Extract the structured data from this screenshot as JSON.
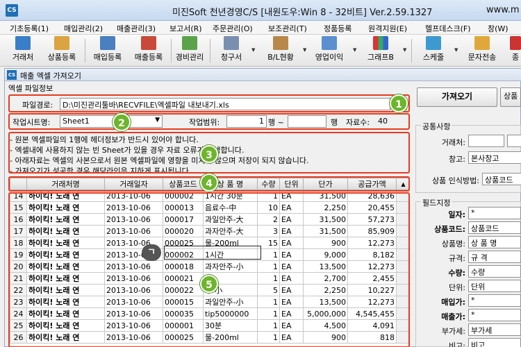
{
  "window": {
    "title": "미진Soft 천년경영C/S [내원도우:Win 8 - 32비트] Ver.2.59.1327",
    "title_tail": "www.m",
    "app_icon": "CS"
  },
  "menu": [
    "기초등록(1)",
    "매입관리(2)",
    "매출관리(3)",
    "보고서(R)",
    "주문관리(O)",
    "보조관리(T)",
    "정품등록",
    "원격지원(E)",
    "헬프데스크(F)",
    "창(W)"
  ],
  "toolbar": [
    "거래처",
    "상품등록",
    "매입등록",
    "매출등록",
    "경비관리",
    "청구서",
    "B/L현황",
    "영업이익",
    "그래프B",
    "스케줄",
    "문자전송",
    "종"
  ],
  "subwindow": {
    "icon": "CS",
    "title": "매출 엑셀 가져오기",
    "group_label": "엑셀 파일정보",
    "path_label": "파일경로:",
    "path_value": "D:\\미진관리툴바\\RECVFILE\\엑셀파일 내보내기.xls",
    "browse_label": "...",
    "sheet_label": "작업시트명:",
    "sheet_value": "Sheet1",
    "range_label": "작업범위:",
    "range_start": "1",
    "range_row1": "행 ~",
    "range_row2": "행",
    "count_label": "자료수:",
    "count_value": "40"
  },
  "notes": [
    "- 원본 엑셀파일의 1행에 헤더정보가 반드시 있어야 합니다.",
    "- 엑셀내에 사용하지 않는 빈 Sheet가 있을 경우 자료 오류가 발생합니다.",
    "- 아래자료는 엑셀의 사본으로서 원본 엑셀파일에 영향을 미치지 않으며 저장이 되지 않습니다.",
    "- 가져오기가 성공한 경우 해당라인은 지하게 표시됩니다."
  ],
  "grid": {
    "headers": [
      "",
      "거래처명",
      "거래일자",
      "상품코드",
      "상 품 명",
      "수량",
      "단위",
      "단가",
      "공급가액",
      "▲"
    ],
    "rows": [
      [
        "14",
        "하이킥! 노래 연",
        "2013-10-06",
        "000002",
        "1시간 30분",
        "1",
        "EA",
        "31,500",
        "28,636"
      ],
      [
        "15",
        "하이킥! 노래 연",
        "2013-10-06",
        "000013",
        "음료수-中",
        "10",
        "EA",
        "2,250",
        "20,455"
      ],
      [
        "16",
        "하이킥! 노래 연",
        "2013-10-06",
        "000017",
        "과일안주-大",
        "2",
        "EA",
        "31,500",
        "57,273"
      ],
      [
        "17",
        "하이킥! 노래 연",
        "2013-10-06",
        "000020",
        "과자안주-大",
        "3",
        "EA",
        "31,500",
        "85,909"
      ],
      [
        "18",
        "하이킥! 노래 연",
        "2013-10-06",
        "000025",
        "물-200ml",
        "15",
        "EA",
        "900",
        "12,273"
      ],
      [
        "19",
        "하이킥! 노래 연",
        "2013-10-06",
        "000002",
        "1시간",
        "1",
        "EA",
        "9,000",
        "8,182"
      ],
      [
        "20",
        "하이킥! 노래 연",
        "2013-10-06",
        "000018",
        "과자안주-小",
        "1",
        "EA",
        "13,500",
        "12,273"
      ],
      [
        "21",
        "하이킥! 노래 연",
        "2013-10-06",
        "000021",
        "주",
        "1",
        "EA",
        "2,700",
        "2,455"
      ],
      [
        "22",
        "하이킥! 노래 연",
        "2013-10-06",
        "000022",
        "주-小",
        "5",
        "EA",
        "2,250",
        "10,227"
      ],
      [
        "23",
        "하이킥! 노래 연",
        "2013-10-06",
        "000015",
        "과일안주-小",
        "1",
        "EA",
        "13,500",
        "12,273"
      ],
      [
        "24",
        "하이킥! 노래 연",
        "2013-10-06",
        "000035",
        "tip5000000",
        "1",
        "EA",
        "5,000,000",
        "4,545,455"
      ],
      [
        "25",
        "하이킥! 노래 연",
        "2013-10-06",
        "000001",
        "30분",
        "1",
        "EA",
        "4,500",
        "4,091"
      ],
      [
        "26",
        "하이킥! 노래 연",
        "2013-10-06",
        "000025",
        "물-200ml",
        "1",
        "EA",
        "900",
        "818"
      ]
    ]
  },
  "right": {
    "import_button": "가져오기",
    "product_button": "상품",
    "common_section": "공통사항",
    "customer_label": "거래처:",
    "warehouse_label": "창고:",
    "warehouse_value": "본사창고",
    "recognize_label": "상품 인식방법:",
    "recognize_value": "상품코드",
    "field_section": "필드지정",
    "fields": [
      {
        "label": "일자:",
        "value": "*",
        "bold": true
      },
      {
        "label": "상품코드:",
        "value": "상품코드",
        "bold": true
      },
      {
        "label": "상품명:",
        "value": "상 품 명",
        "bold": false
      },
      {
        "label": "규격:",
        "value": "규 격",
        "bold": false
      },
      {
        "label": "수량:",
        "value": "수량",
        "bold": true
      },
      {
        "label": "단위:",
        "value": "단위",
        "bold": false
      },
      {
        "label": "매입가:",
        "value": "*",
        "bold": true
      },
      {
        "label": "매출가:",
        "value": "*",
        "bold": true
      },
      {
        "label": "부가세:",
        "value": "부가세",
        "bold": false
      },
      {
        "label": "비고:",
        "value": "비고",
        "bold": false
      }
    ]
  },
  "badges": [
    "1",
    "2",
    "3",
    "4",
    "5"
  ],
  "overlay_label": "ㄱ",
  "colors": {
    "annotation_red": "#e8391d",
    "badge_green": "#6db52b",
    "titlebar": "#c6d9f0"
  }
}
